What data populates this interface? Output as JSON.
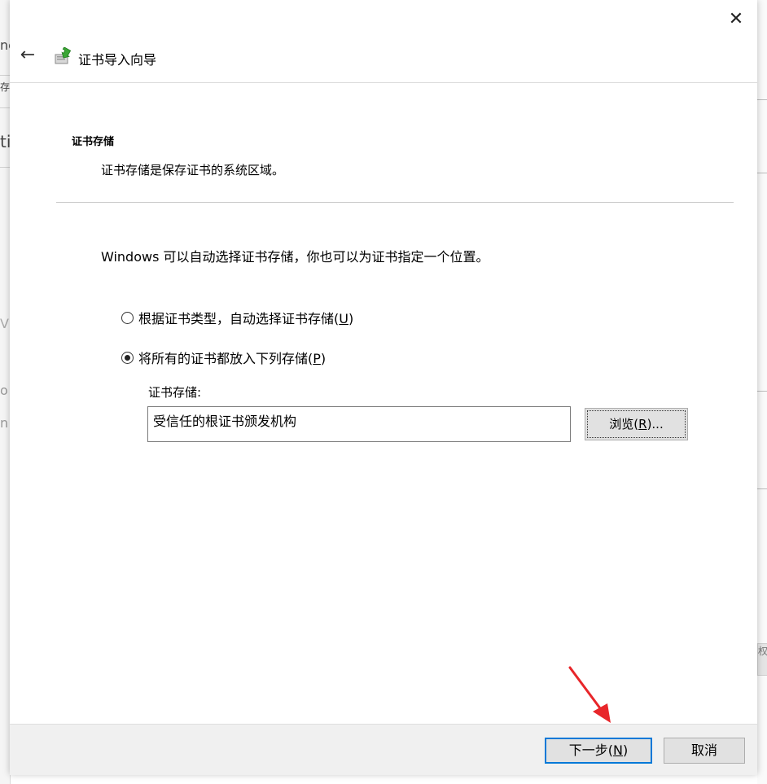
{
  "background": {
    "left_fragments": [
      "ne",
      "存",
      "ti",
      "Vi",
      "o",
      "n"
    ],
    "right_fragment": "权"
  },
  "dialog": {
    "close_glyph": "✕",
    "back_glyph": "←",
    "title": "证书导入向导",
    "section": {
      "title": "证书存储",
      "description": "证书存储是保存证书的系统区域。"
    },
    "intro": "Windows 可以自动选择证书存储，你也可以为证书指定一个位置。",
    "options": [
      {
        "label": "根据证书类型，自动选择证书存储(",
        "accel": "U",
        "suffix": ")",
        "selected": false
      },
      {
        "label": "将所有的证书都放入下列存储(",
        "accel": "P",
        "suffix": ")",
        "selected": true
      }
    ],
    "store": {
      "label": "证书存储:",
      "value": "受信任的根证书颁发机构",
      "browse_label": "浏览(",
      "browse_accel": "R",
      "browse_suffix": ")..."
    },
    "footer": {
      "next_label": "下一步(",
      "next_accel": "N",
      "next_suffix": ")",
      "cancel_label": "取消"
    }
  },
  "colors": {
    "accent": "#0078d7",
    "annotation_arrow": "#e8262a",
    "footer_bg": "#f0f0f0",
    "button_bg": "#e1e1e1"
  },
  "icons": {
    "close": "close-icon",
    "back": "back-arrow-icon",
    "wizard": "certificate-import-icon",
    "annotation": "red-arrow-annotation"
  }
}
